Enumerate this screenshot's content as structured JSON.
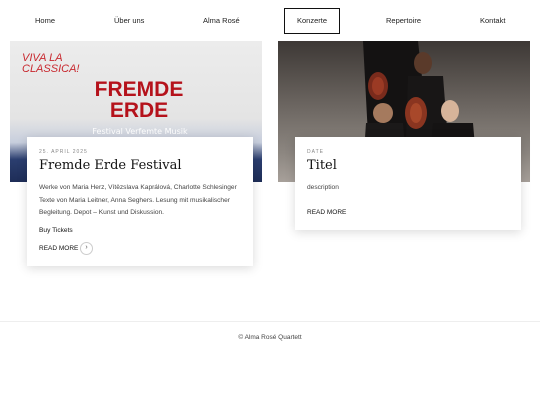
{
  "nav": {
    "items": [
      {
        "label": "Home"
      },
      {
        "label": "Über uns"
      },
      {
        "label": "Alma Rosé"
      },
      {
        "label": "Konzerte"
      },
      {
        "label": "Repertoire"
      },
      {
        "label": "Kontakt"
      }
    ],
    "active": "Konzerte"
  },
  "cards": [
    {
      "image_text": {
        "viva": "VIVA LA CLASSICA!",
        "fremde": "FREMDE ERDE",
        "festival": "Festival Verfemte Musik"
      },
      "date": "25. APRIL 2025",
      "title": "Fremde Erde Festival",
      "description": "Werke von Maria Herz, Vítězslava Kaprálová, Charlotte Schlesinger Texte von Maria Leitner, Anna Seghers. Lesung mit musikalischer Begleitung. Depot – Kunst und Diskussion.",
      "tickets": "Buy Tickets",
      "read_more": "READ MORE",
      "arrow": "›"
    },
    {
      "date": "DATE",
      "title": "Titel",
      "description": "description",
      "read_more": "READ MORE"
    }
  ],
  "footer": {
    "copyright": "© Alma Rosé Quartett"
  },
  "colors": {
    "brand_red": "#b5121b",
    "accent_red": "#c8282f",
    "navy": "#1e2d57"
  }
}
